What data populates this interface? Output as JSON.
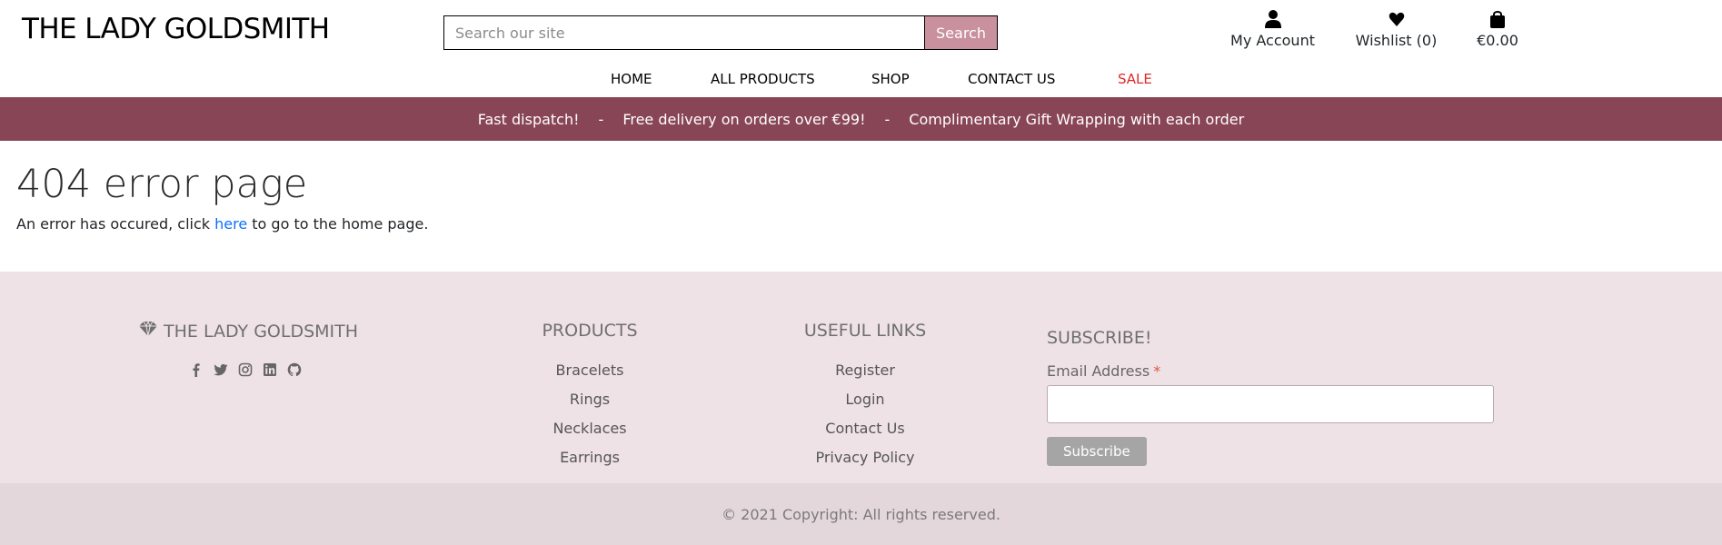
{
  "header": {
    "brand": "THE LADY GOLDSMITH",
    "search": {
      "placeholder": "Search our site",
      "button_label": "Search"
    },
    "account_links": [
      {
        "icon": "user-icon",
        "label": "My Account"
      },
      {
        "icon": "heart-icon",
        "label": "Wishlist (0)"
      },
      {
        "icon": "shopping-bag-icon",
        "label": "€0.00"
      }
    ]
  },
  "nav": {
    "items": [
      "HOME",
      "ALL PRODUCTS",
      "SHOP",
      "CONTACT US",
      "SALE"
    ],
    "sale_color": "#e02828"
  },
  "banner": {
    "background": "#884556",
    "messages": [
      "Fast dispatch!",
      "Free delivery on orders over €99!",
      "Complimentary Gift Wrapping with each order"
    ],
    "separator": "-"
  },
  "main": {
    "title": "404 error page",
    "text_before": "An error has occured, click",
    "link_text": "here",
    "text_after": "to go to the home page."
  },
  "footer": {
    "brand": "THE LADY GOLDSMITH",
    "brand_icon": "gem-icon",
    "socials": [
      "facebook-icon",
      "twitter-icon",
      "instagram-icon",
      "linkedin-icon",
      "github-icon"
    ],
    "products": {
      "title": "PRODUCTS",
      "items": [
        "Bracelets",
        "Rings",
        "Necklaces",
        "Earrings"
      ]
    },
    "useful_links": {
      "title": "USEFUL LINKS",
      "items": [
        "Register",
        "Login",
        "Contact Us",
        "Privacy Policy"
      ]
    },
    "subscribe": {
      "title": "SUBSCRIBE!",
      "email_label": "Email Address",
      "required_marker": "*",
      "button_label": "Subscribe"
    },
    "copyright": "© 2021 Copyright: All rights reserved."
  },
  "colors": {
    "search_button": "#c9909e",
    "footer_bg": "#efe2e7",
    "copyright_bg": "#e4d7dc",
    "link": "#0d6efd"
  }
}
